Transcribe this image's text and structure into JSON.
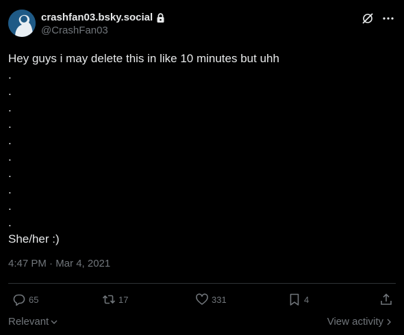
{
  "author": {
    "display_name": "crashfan03.bsky.social",
    "handle": "@CrashFan03",
    "protected": true
  },
  "post": {
    "lines": [
      "Hey guys i may delete this in like 10 minutes but uhh",
      ".",
      ".",
      ".",
      ".",
      ".",
      ".",
      ".",
      ".",
      ".",
      ".",
      "She/her :)"
    ],
    "timestamp": "4:47 PM · Mar 4, 2021"
  },
  "engagement": {
    "replies": "65",
    "reposts": "17",
    "likes": "331",
    "bookmarks": "4"
  },
  "footer": {
    "sort_label": "Relevant",
    "view_activity_label": "View activity"
  },
  "colors": {
    "background": "#000000",
    "text_primary": "#e7e9ea",
    "text_secondary": "#71767b",
    "divider": "#2f3336",
    "avatar_bg": "#1f5a86"
  },
  "icons": {
    "header": [
      "grok-icon",
      "more-icon",
      "lock-icon"
    ],
    "actions": [
      "reply-icon",
      "repost-icon",
      "like-icon",
      "bookmark-icon",
      "share-icon"
    ]
  }
}
